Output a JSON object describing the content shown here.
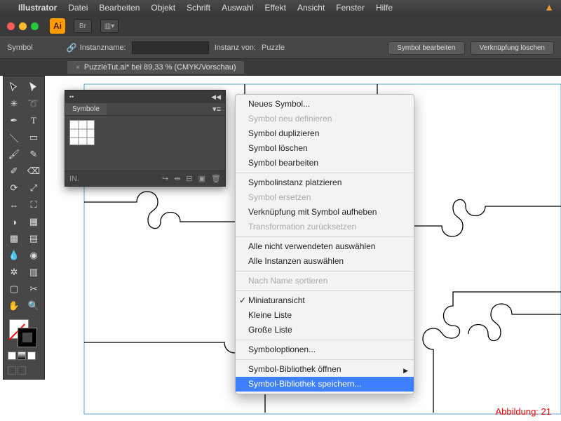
{
  "menubar": [
    "Illustrator",
    "Datei",
    "Bearbeiten",
    "Objekt",
    "Schrift",
    "Auswahl",
    "Effekt",
    "Ansicht",
    "Fenster",
    "Hilfe"
  ],
  "controlbar": {
    "mode_label": "Symbol",
    "instance_label": "Instanzname:",
    "instance_value": "",
    "instance_of_label": "Instanz von:",
    "instance_of_value": "Puzzle",
    "btn_edit": "Symbol bearbeiten",
    "btn_unlink": "Verknüpfung löschen"
  },
  "tab": {
    "close": "×",
    "title": "PuzzleTut.ai* bei 89,33 % (CMYK/Vorschau)"
  },
  "panel": {
    "title": "Symbole",
    "footer_left": "IN."
  },
  "context_menu": {
    "items": [
      {
        "label": "Neues Symbol...",
        "type": "item"
      },
      {
        "label": "Symbol neu definieren",
        "type": "disabled"
      },
      {
        "label": "Symbol duplizieren",
        "type": "item"
      },
      {
        "label": "Symbol löschen",
        "type": "item"
      },
      {
        "label": "Symbol bearbeiten",
        "type": "item"
      },
      {
        "type": "sep"
      },
      {
        "label": "Symbolinstanz platzieren",
        "type": "item"
      },
      {
        "label": "Symbol ersetzen",
        "type": "disabled"
      },
      {
        "label": "Verknüpfung mit Symbol aufheben",
        "type": "item"
      },
      {
        "label": "Transformation zurücksetzen",
        "type": "disabled"
      },
      {
        "type": "sep"
      },
      {
        "label": "Alle nicht verwendeten auswählen",
        "type": "item"
      },
      {
        "label": "Alle Instanzen auswählen",
        "type": "item"
      },
      {
        "type": "sep"
      },
      {
        "label": "Nach Name sortieren",
        "type": "disabled"
      },
      {
        "type": "sep"
      },
      {
        "label": "Miniaturansicht",
        "type": "checked"
      },
      {
        "label": "Kleine Liste",
        "type": "item"
      },
      {
        "label": "Große Liste",
        "type": "item"
      },
      {
        "type": "sep"
      },
      {
        "label": "Symboloptionen...",
        "type": "item"
      },
      {
        "type": "sep"
      },
      {
        "label": "Symbol-Bibliothek öffnen",
        "type": "submenu"
      },
      {
        "label": "Symbol-Bibliothek speichern...",
        "type": "hl"
      }
    ]
  },
  "caption": "Abbildung: 21",
  "ai_badge": "Ai",
  "br_badge": "Br"
}
